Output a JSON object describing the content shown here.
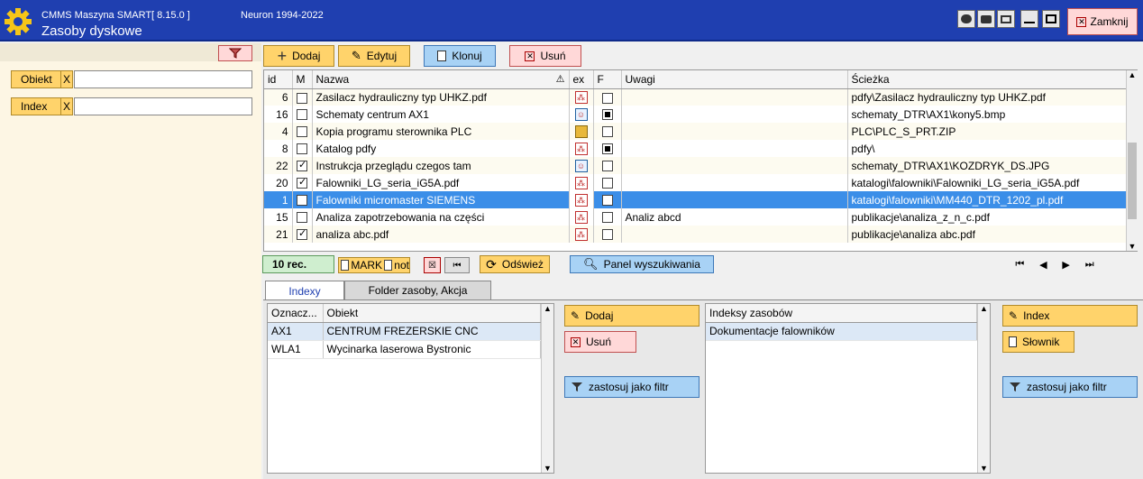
{
  "titlebar": {
    "app_name": "CMMS Maszyna SMART",
    "app_version": "[  8.15.0 ]",
    "neuron": "Neuron 1994-2022",
    "window_title": "Zasoby dyskowe",
    "close_label": "Zamknij"
  },
  "filters": {
    "obiekt_label": "Obiekt",
    "index_label": "Index",
    "clear_label": "X",
    "obiekt_value": "",
    "index_value": ""
  },
  "toolbar": {
    "add": "Dodaj",
    "edit": "Edytuj",
    "clone": "Klonuj",
    "delete": "Usuń"
  },
  "table": {
    "columns": [
      "id",
      "M",
      "Nazwa",
      "ex",
      "F",
      "Uwagi",
      "Ścieżka"
    ],
    "rows": [
      {
        "id": "6",
        "m": false,
        "nazwa": "Zasilacz hydrauliczny typ UHKZ.pdf",
        "ex": "pdf",
        "f": false,
        "uwagi": "",
        "sciezka": "pdfy\\Zasilacz hydrauliczny typ UHKZ.pdf"
      },
      {
        "id": "16",
        "m": false,
        "nazwa": "Schematy centrum AX1",
        "ex": "img",
        "f": true,
        "uwagi": "",
        "sciezka": "schematy_DTR\\AX1\\kony5.bmp"
      },
      {
        "id": "4",
        "m": false,
        "nazwa": "Kopia programu sterownika PLC",
        "ex": "zip",
        "f": false,
        "uwagi": "",
        "sciezka": "PLC\\PLC_S_PRT.ZIP"
      },
      {
        "id": "8",
        "m": false,
        "nazwa": "Katalog pdfy",
        "ex": "pdf",
        "f": true,
        "uwagi": "",
        "sciezka": "pdfy\\"
      },
      {
        "id": "22",
        "m": true,
        "nazwa": "Instrukcja przeglądu czegos tam",
        "ex": "img",
        "f": false,
        "uwagi": "",
        "sciezka": "schematy_DTR\\AX1\\KOZDRYK_DS.JPG"
      },
      {
        "id": "20",
        "m": true,
        "nazwa": "Falowniki_LG_seria_iG5A.pdf",
        "ex": "pdf",
        "f": false,
        "uwagi": "",
        "sciezka": "katalogi\\falowniki\\Falowniki_LG_seria_iG5A.pdf"
      },
      {
        "id": "1",
        "m": false,
        "nazwa": "Falowniki micromaster SIEMENS",
        "ex": "pdf",
        "f": false,
        "uwagi": "",
        "sciezka": "katalogi\\falowniki\\MM440_DTR_1202_pl.pdf",
        "selected": true
      },
      {
        "id": "15",
        "m": false,
        "nazwa": "Analiza zapotrzebowania na części",
        "ex": "pdf",
        "f": false,
        "uwagi": "Analiz abcd",
        "sciezka": "publikacje\\analiza_z_n_c.pdf"
      },
      {
        "id": "21",
        "m": true,
        "nazwa": "analiza abc.pdf",
        "ex": "pdf",
        "f": false,
        "uwagi": "",
        "sciezka": "publikacje\\analiza abc.pdf"
      }
    ]
  },
  "status": {
    "records": "10 rec.",
    "mark": "MARK",
    "not": "not",
    "refresh": "Odśwież",
    "search_panel": "Panel wyszukiwania"
  },
  "tabs": {
    "indexy": "Indexy",
    "folder": "Folder zasoby, Akcja"
  },
  "objects_grid": {
    "col1": "Oznacz...",
    "col2": "Obiekt",
    "rows": [
      {
        "code": "AX1",
        "name": "CENTRUM FREZERSKIE CNC"
      },
      {
        "code": "WLA1",
        "name": "Wycinarka laserowa Bystronic"
      }
    ]
  },
  "mid_actions": {
    "add": "Dodaj",
    "delete": "Usuń",
    "apply_filter": "zastosuj jako filtr"
  },
  "index_grid": {
    "header": "Indeksy zasobów",
    "rows": [
      "Dokumentacje falowników"
    ]
  },
  "right_actions": {
    "index": "Index",
    "dictionary": "Słownik",
    "apply_filter": "zastosuj jako filtr"
  }
}
